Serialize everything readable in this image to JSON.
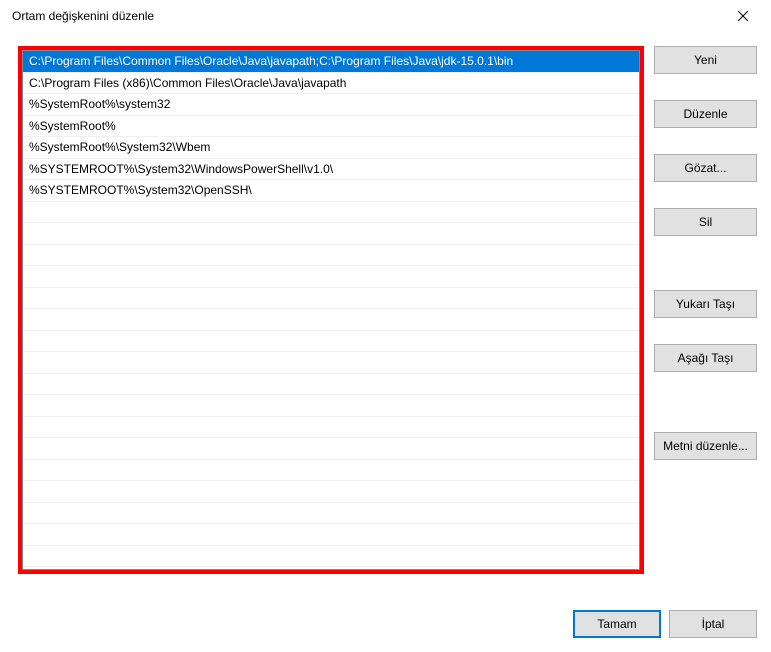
{
  "window": {
    "title": "Ortam değişkenini düzenle"
  },
  "list": {
    "items": [
      "C:\\Program Files\\Common Files\\Oracle\\Java\\javapath;C:\\Program Files\\Java\\jdk-15.0.1\\bin",
      "C:\\Program Files (x86)\\Common Files\\Oracle\\Java\\javapath",
      "%SystemRoot%\\system32",
      "%SystemRoot%",
      "%SystemRoot%\\System32\\Wbem",
      "%SYSTEMROOT%\\System32\\WindowsPowerShell\\v1.0\\",
      "%SYSTEMROOT%\\System32\\OpenSSH\\"
    ],
    "selectedIndex": 0
  },
  "buttons": {
    "new": "Yeni",
    "edit": "Düzenle",
    "browse": "Gözat...",
    "delete": "Sil",
    "moveUp": "Yukarı Taşı",
    "moveDown": "Aşağı Taşı",
    "editText": "Metni düzenle...",
    "ok": "Tamam",
    "cancel": "İptal"
  }
}
